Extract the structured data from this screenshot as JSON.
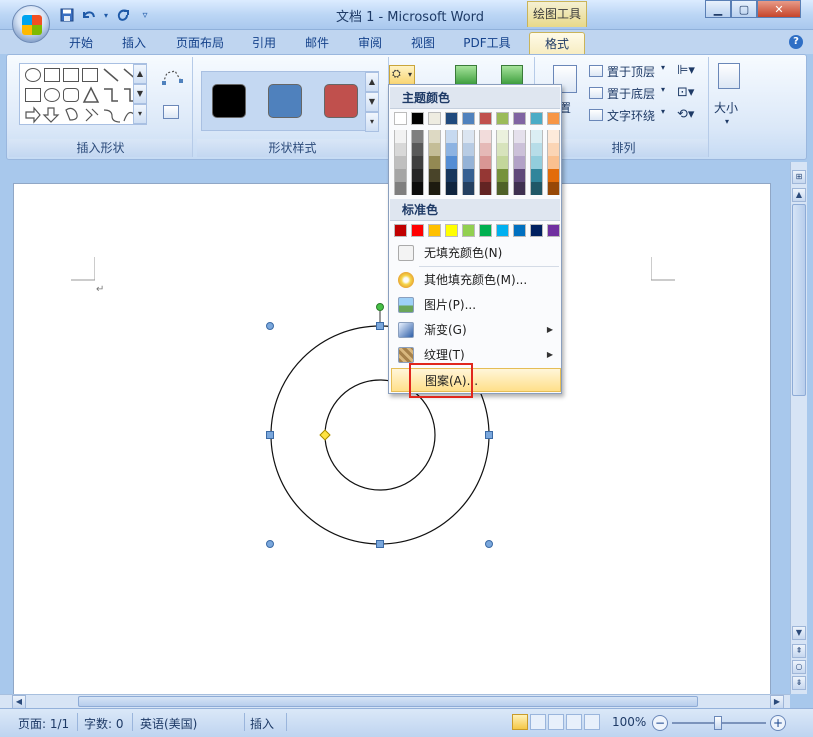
{
  "titlebar": {
    "document_title": "文档 1 - Microsoft Word",
    "context_tab_group": "绘图工具",
    "qat_items": [
      "save-icon",
      "undo-icon",
      "redo-icon",
      "customize-icon"
    ]
  },
  "tabs": [
    "开始",
    "插入",
    "页面布局",
    "引用",
    "邮件",
    "审阅",
    "视图",
    "PDF工具",
    "格式"
  ],
  "active_tab": "格式",
  "ribbon": {
    "groups": {
      "insert_shapes": "插入形状",
      "shape_styles": "形状样式",
      "arrange": "排列",
      "size": "大小"
    },
    "shape_style_colors": [
      "#000000",
      "#4f81bd",
      "#c0504d"
    ],
    "arrange_items": {
      "bring_to_front": "置于顶层",
      "send_to_back": "置于底层",
      "text_wrap": "文字环绕",
      "position_fragment": "置"
    }
  },
  "fill_menu": {
    "theme_colors_header": "主题颜色",
    "standard_colors_header": "标准色",
    "theme_top_row": [
      "#ffffff",
      "#000000",
      "#eeece1",
      "#1f497d",
      "#4f81bd",
      "#c0504d",
      "#9bbb59",
      "#8064a2",
      "#4bacc6",
      "#f79646"
    ],
    "theme_shades": [
      [
        "#f2f2f2",
        "#d8d8d8",
        "#bfbfbf",
        "#a5a5a5",
        "#7f7f7f"
      ],
      [
        "#7f7f7f",
        "#595959",
        "#3f3f3f",
        "#262626",
        "#0c0c0c"
      ],
      [
        "#ddd9c3",
        "#c4bd97",
        "#938953",
        "#494429",
        "#1d1b10"
      ],
      [
        "#c6d9f0",
        "#8db3e2",
        "#548dd4",
        "#17365d",
        "#0f243e"
      ],
      [
        "#dbe5f1",
        "#b8cce4",
        "#95b3d7",
        "#366092",
        "#244061"
      ],
      [
        "#f2dcdb",
        "#e5b9b7",
        "#d99694",
        "#953734",
        "#632423"
      ],
      [
        "#ebf1dd",
        "#d7e3bc",
        "#c3d69b",
        "#76923c",
        "#4f6128"
      ],
      [
        "#e5e0ec",
        "#ccc1d9",
        "#b2a2c7",
        "#5f497a",
        "#3f3151"
      ],
      [
        "#dbeef3",
        "#b7dde8",
        "#92cddc",
        "#31859b",
        "#205867"
      ],
      [
        "#fdeada",
        "#fbd5b5",
        "#fac08f",
        "#e36c09",
        "#974806"
      ]
    ],
    "standard_colors": [
      "#c00000",
      "#ff0000",
      "#ffc000",
      "#ffff00",
      "#92d050",
      "#00b050",
      "#00b0f0",
      "#0070c0",
      "#002060",
      "#7030a0"
    ],
    "items": [
      {
        "label": "无填充颜色(N)",
        "icon": "no-fill-icon",
        "submenu": false
      },
      {
        "label": "其他填充颜色(M)...",
        "icon": "palette-icon",
        "submenu": false
      },
      {
        "label": "图片(P)...",
        "icon": "picture-icon",
        "submenu": false
      },
      {
        "label": "渐变(G)",
        "icon": "gradient-icon",
        "submenu": true
      },
      {
        "label": "纹理(T)",
        "icon": "texture-icon",
        "submenu": true
      },
      {
        "label": "图案(A)...",
        "icon": "pattern-icon",
        "submenu": false
      }
    ]
  },
  "statusbar": {
    "page": "页面: 1/1",
    "words": "字数: 0",
    "language": "英语(美国)",
    "mode": "插入",
    "zoom": "100%",
    "zoom_minus": "−",
    "zoom_plus": "+"
  }
}
